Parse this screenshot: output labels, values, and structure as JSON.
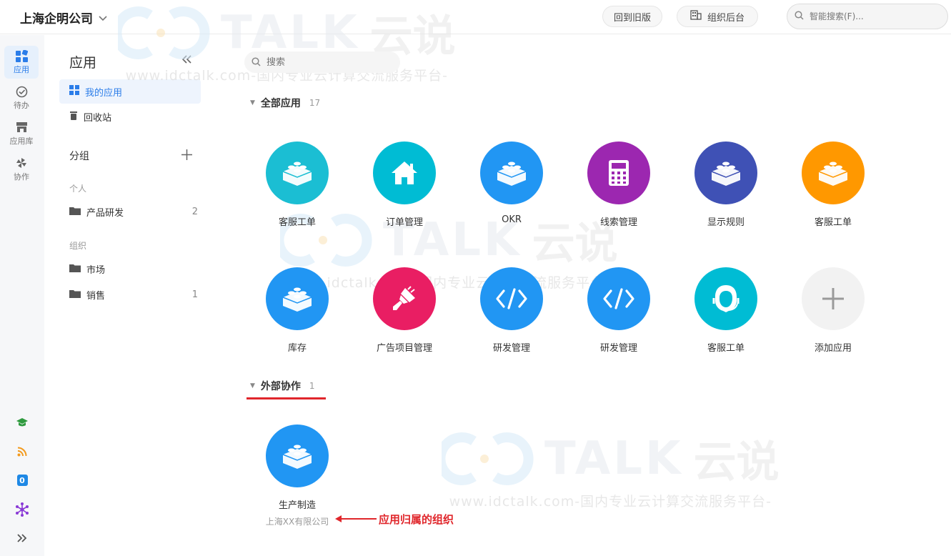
{
  "topbar": {
    "company": "上海企明公司",
    "back_old": "回到旧版",
    "org_admin": "组织后台",
    "search_placeholder": "智能搜索(F)..."
  },
  "rail": {
    "items": [
      {
        "label": "应用",
        "icon": "apps-grid-icon",
        "active": true
      },
      {
        "label": "待办",
        "icon": "check-circle-icon",
        "active": false
      },
      {
        "label": "应用库",
        "icon": "store-icon",
        "active": false
      },
      {
        "label": "协作",
        "icon": "pinwheel-icon",
        "active": false
      }
    ],
    "bottom_icons": [
      "graduation-cap-icon",
      "rss-icon",
      "zero-badge-icon",
      "network-icon",
      "expand-icon"
    ],
    "zero_badge_text": "0"
  },
  "panel": {
    "title": "应用",
    "my_apps": "我的应用",
    "recycle": "回收站",
    "group_title": "分组",
    "personal_label": "个人",
    "personal_groups": [
      {
        "name": "产品研发",
        "count": "2"
      }
    ],
    "org_label": "组织",
    "org_groups": [
      {
        "name": "市场",
        "count": ""
      },
      {
        "name": "销售",
        "count": "1"
      }
    ]
  },
  "main": {
    "search_placeholder": "搜索",
    "all_apps_title": "全部应用",
    "all_apps_count": "17",
    "apps": [
      {
        "name": "客服工单",
        "color": "#1bbed3",
        "icon": "lego-brick-icon"
      },
      {
        "name": "订单管理",
        "color": "#00bcd4",
        "icon": "house-icon"
      },
      {
        "name": "OKR",
        "color": "#2196f3",
        "icon": "lego-brick-icon"
      },
      {
        "name": "线索管理",
        "color": "#9c27b0",
        "icon": "calculator-icon"
      },
      {
        "name": "显示规则",
        "color": "#3f51b5",
        "icon": "lego-brick-icon"
      },
      {
        "name": "客服工单",
        "color": "#ff9800",
        "icon": "lego-brick-icon"
      },
      {
        "name": "库存",
        "color": "#2196f3",
        "icon": "lego-brick-icon"
      },
      {
        "name": "广告项目管理",
        "color": "#e91e63",
        "icon": "paint-brush-icon"
      },
      {
        "name": "研发管理",
        "color": "#2196f3",
        "icon": "code-icon"
      },
      {
        "name": "研发管理",
        "color": "#2196f3",
        "icon": "code-icon"
      },
      {
        "name": "客服工单",
        "color": "#00bcd4",
        "icon": "headset-agent-icon"
      },
      {
        "name": "添加应用",
        "color": "#f2f2f2",
        "icon": "plus-icon"
      }
    ],
    "external_title": "外部协作",
    "external_count": "1",
    "external_apps": [
      {
        "name": "生产制造",
        "org": "上海XX有限公司",
        "color": "#2196f3",
        "icon": "lego-brick-icon"
      }
    ],
    "annotation": "应用归属的组织"
  },
  "watermark": {
    "brand": "TALK",
    "brand_cn": "云说",
    "url": "www.idctalk.com-国内专业云计算交流服务平台-"
  }
}
